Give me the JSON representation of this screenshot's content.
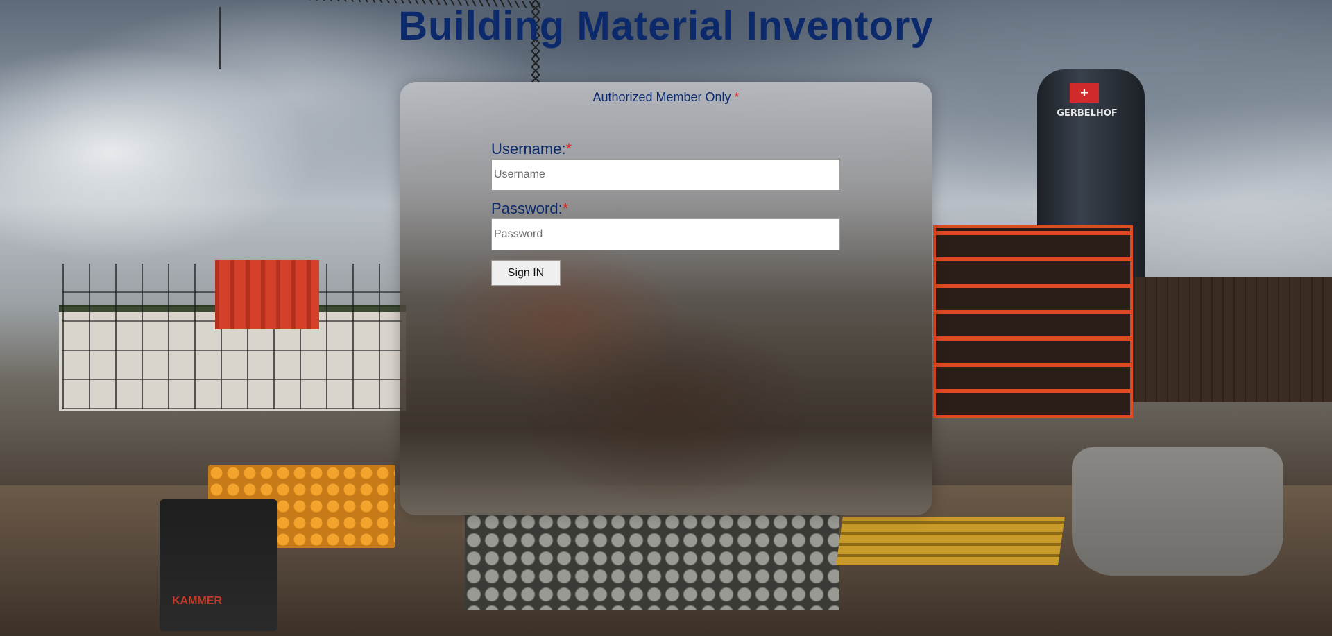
{
  "page": {
    "title": "Building Material Inventory"
  },
  "login": {
    "header": "Authorized Member Only",
    "required_mark": "*",
    "username_label": "Username:",
    "username_placeholder": "Username",
    "username_value": "",
    "password_label": "Password:",
    "password_placeholder": "Password",
    "password_value": "",
    "submit_label": "Sign IN"
  },
  "background": {
    "silo_badge": "+",
    "silo_text": "GERBELHOF",
    "saw_text": "KAMMER"
  },
  "colors": {
    "title": "#0c2a6b",
    "required": "#e02020",
    "button_bg": "#efefef"
  }
}
